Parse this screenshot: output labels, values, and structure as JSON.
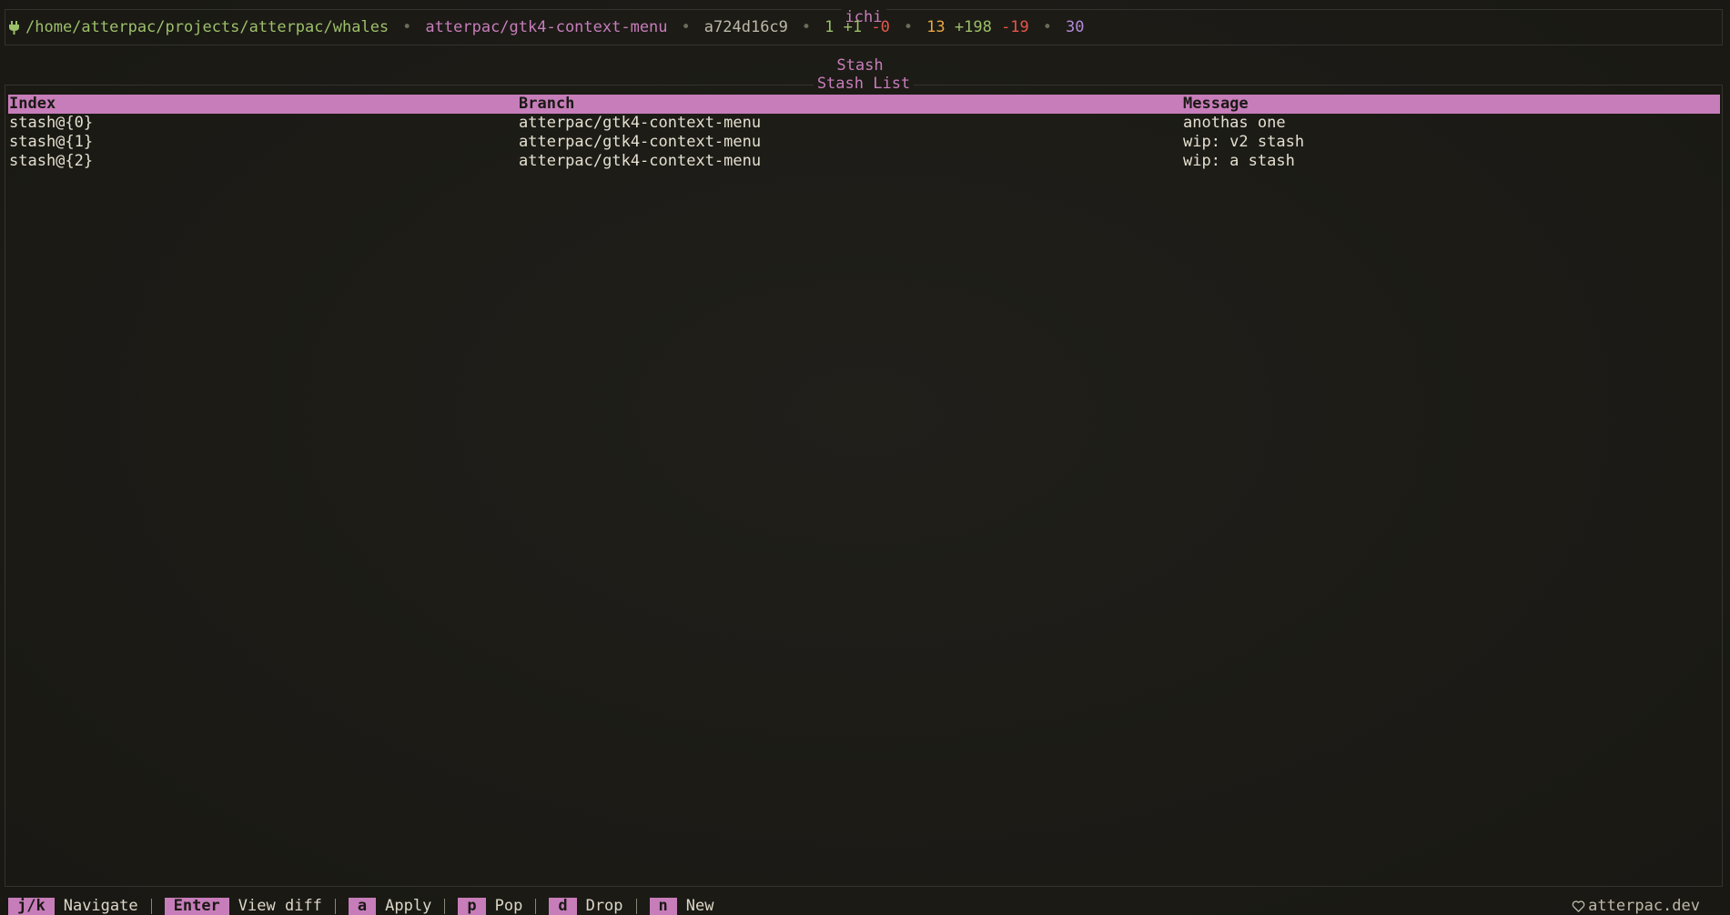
{
  "app": {
    "title": "ichi",
    "brand": "atterpac.dev",
    "heart_icon": "heart-outline-icon"
  },
  "status": {
    "repo_icon": "git-plug-icon",
    "path": "/home/atterpac/projects/atterpac/whales",
    "branch": "atterpac/gtk4-context-menu",
    "commit": "a724d16c9",
    "ahead_count": "1",
    "ahead_plus": "+1",
    "ahead_minus": "-0",
    "files_changed": "13",
    "insertions": "+198",
    "deletions": "-19",
    "stash_count": "30",
    "separator": "•"
  },
  "view": {
    "title": "Stash",
    "panel_title": "Stash List"
  },
  "table": {
    "headers": {
      "index": "Index",
      "branch": "Branch",
      "message": "Message"
    },
    "rows": [
      {
        "index": "stash@{0}",
        "branch": "atterpac/gtk4-context-menu",
        "message": "anothas one"
      },
      {
        "index": "stash@{1}",
        "branch": "atterpac/gtk4-context-menu",
        "message": "wip: v2 stash"
      },
      {
        "index": "stash@{2}",
        "branch": "atterpac/gtk4-context-menu",
        "message": "wip: a stash"
      }
    ]
  },
  "footer": {
    "hints": [
      {
        "key": "j/k",
        "label": "Navigate"
      },
      {
        "key": "Enter",
        "label": "View diff"
      },
      {
        "key": "a",
        "label": "Apply"
      },
      {
        "key": "p",
        "label": "Pop"
      },
      {
        "key": "d",
        "label": "Drop"
      },
      {
        "key": "n",
        "label": "New"
      }
    ]
  },
  "colors": {
    "accent": "#c77dba",
    "background": "#1c1b16",
    "path_green": "#9cbf6a",
    "deletion_red": "#e5574a",
    "files_orange": "#e8a646",
    "stash_violet": "#b48ad8"
  }
}
